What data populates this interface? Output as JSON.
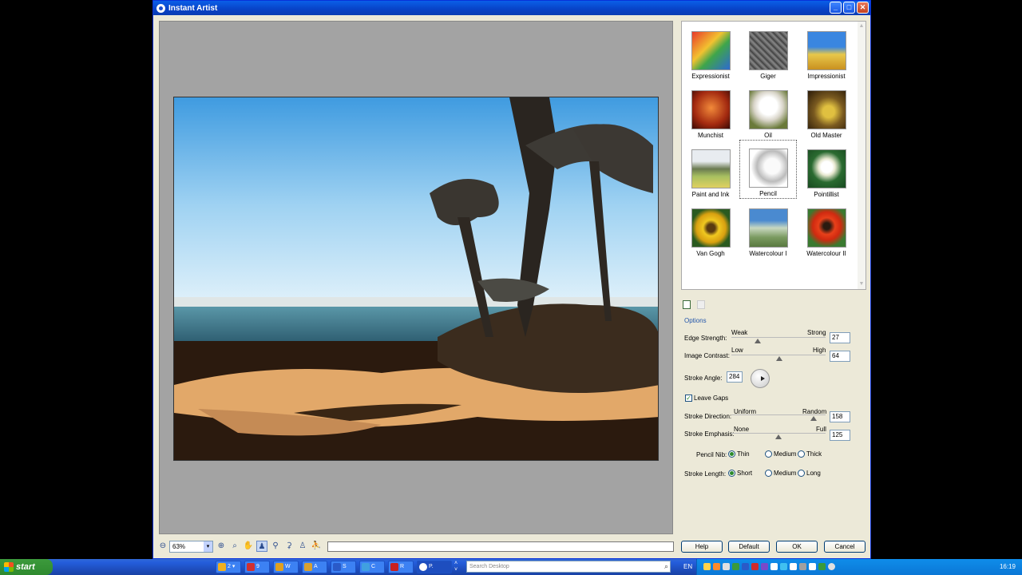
{
  "window": {
    "title": "Instant Artist"
  },
  "styles": [
    {
      "label": "Expressionist"
    },
    {
      "label": "Giger"
    },
    {
      "label": "Impressionist"
    },
    {
      "label": "Munchist"
    },
    {
      "label": "Oil"
    },
    {
      "label": "Old Master"
    },
    {
      "label": "Paint and Ink"
    },
    {
      "label": "Pencil"
    },
    {
      "label": "Pointillist"
    },
    {
      "label": "Van Gogh"
    },
    {
      "label": "Watercolour I"
    },
    {
      "label": "Watercolour II"
    }
  ],
  "options": {
    "heading": "Options",
    "edge_strength": {
      "label": "Edge Strength:",
      "min_label": "Weak",
      "max_label": "Strong",
      "value": "27"
    },
    "image_contrast": {
      "label": "Image Contrast:",
      "min_label": "Low",
      "max_label": "High",
      "value": "64"
    },
    "stroke_angle": {
      "label": "Stroke Angle:",
      "value": "284"
    },
    "leave_gaps": {
      "label": "Leave Gaps",
      "checked": true
    },
    "stroke_direction": {
      "label": "Stroke Direction:",
      "min_label": "Uniform",
      "max_label": "Random",
      "value": "158"
    },
    "stroke_emphasis": {
      "label": "Stroke Emphasis:",
      "min_label": "None",
      "max_label": "Full",
      "value": "125"
    },
    "pencil_nib": {
      "label": "Pencil Nib:",
      "options": [
        "Thin",
        "Medium",
        "Thick"
      ],
      "selected": "Thin"
    },
    "stroke_length": {
      "label": "Stroke Length:",
      "options": [
        "Short",
        "Medium",
        "Long"
      ],
      "selected": "Short"
    }
  },
  "toolbar": {
    "zoom": "63%",
    "zoom_arrow": "▾"
  },
  "buttons": {
    "help": "Help",
    "default": "Default",
    "ok": "OK",
    "cancel": "Cancel"
  },
  "taskbar": {
    "start": "start",
    "tasks": [
      {
        "label": "2 ▾"
      },
      {
        "label": "9"
      },
      {
        "label": "W"
      },
      {
        "label": "A"
      },
      {
        "label": "S"
      },
      {
        "label": "C"
      },
      {
        "label": "R"
      },
      {
        "label": "P."
      }
    ],
    "search_placeholder": "Search Desktop",
    "language": "EN",
    "clock": "16:19"
  }
}
